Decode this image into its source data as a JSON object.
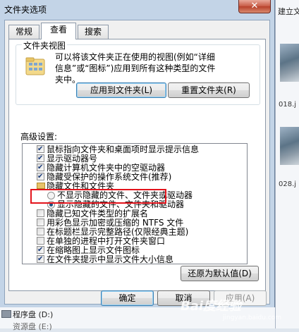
{
  "background": {
    "toolbar_fragment": "建立文件",
    "file_fragments": [
      "018.j",
      "028.j"
    ],
    "drive_label": "程序盘 (D:)",
    "drive_label_2": "资源盘 (E:)",
    "watermark": "Bai度经验",
    "watermark_url": "jingyan.baidu.com"
  },
  "dialog": {
    "title": "文件夹选项",
    "close_label": "✕",
    "tabs": [
      "常规",
      "查看",
      "搜索"
    ],
    "active_tab": "查看",
    "folder_views": {
      "group_label": "文件夹视图",
      "description": "可以将该文件夹正在使用的视图(例如“详细信息”或“图标”)应用到所有这种类型的文件夹中。",
      "apply_button": "应用到文件夹(L)",
      "reset_button": "重置文件夹(R)"
    },
    "advanced": {
      "label": "高级设置:",
      "items": [
        {
          "type": "checkbox",
          "checked": true,
          "label": "鼠标指向文件夹和桌面项时显示提示信息"
        },
        {
          "type": "checkbox",
          "checked": true,
          "label": "显示驱动器号"
        },
        {
          "type": "checkbox",
          "checked": true,
          "label": "隐藏计算机文件夹中的空驱动器"
        },
        {
          "type": "checkbox",
          "checked": true,
          "label": "隐藏受保护的操作系统文件(推荐)"
        },
        {
          "type": "folder",
          "label": "隐藏文件和文件夹"
        },
        {
          "type": "radio",
          "selected": false,
          "label": "不显示隐藏的文件、文件夹或驱动器"
        },
        {
          "type": "radio",
          "selected": true,
          "label": "显示隐藏的文件、文件夹和驱动器"
        },
        {
          "type": "checkbox",
          "checked": false,
          "label": "隐藏已知文件类型的扩展名"
        },
        {
          "type": "checkbox",
          "checked": false,
          "label": "用彩色显示加密或压缩的 NTFS 文件"
        },
        {
          "type": "checkbox",
          "checked": false,
          "label": "在标题栏显示完整路径(仅限经典主题)"
        },
        {
          "type": "checkbox",
          "checked": false,
          "label": "在单独的进程中打开文件夹窗口"
        },
        {
          "type": "checkbox",
          "checked": true,
          "label": "在缩略图上显示文件图标"
        },
        {
          "type": "checkbox",
          "checked": true,
          "label": "在文件夹提示中显示文件大小信息"
        }
      ],
      "restore_button": "还原为默认值(D)"
    },
    "buttons": {
      "ok": "确定",
      "cancel": "取消",
      "apply": "应用(A)"
    }
  }
}
